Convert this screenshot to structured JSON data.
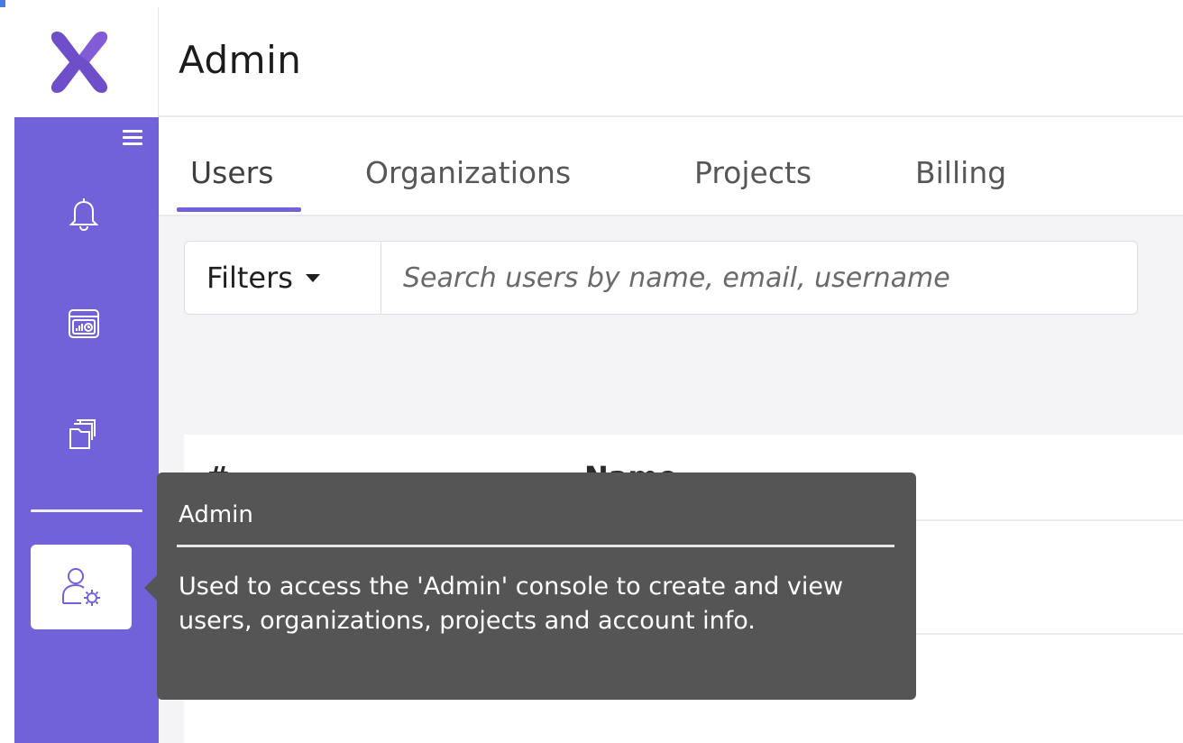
{
  "app": {
    "brand_color": "#7162d9",
    "logo_icon": "x-logo-icon"
  },
  "header": {
    "title": "Admin"
  },
  "sidebar": {
    "menu_icon": "hamburger-icon",
    "items": [
      {
        "icon": "bell-icon",
        "name": "notifications"
      },
      {
        "icon": "dashboard-chart-icon",
        "name": "dashboards"
      },
      {
        "icon": "folders-icon",
        "name": "projects"
      },
      {
        "icon": "user-gear-icon",
        "name": "admin",
        "active": true
      }
    ]
  },
  "tabs": [
    {
      "label": "Users",
      "active": true
    },
    {
      "label": "Organizations",
      "active": false
    },
    {
      "label": "Projects",
      "active": false
    },
    {
      "label": "Billing",
      "active": false
    }
  ],
  "search": {
    "filters_label": "Filters",
    "placeholder": "Search users by name, email, username"
  },
  "table": {
    "columns": [
      "#",
      "Name"
    ]
  },
  "tooltip": {
    "title": "Admin",
    "body": "Used to access the 'Admin' console to create and view users, organizations, projects and account info."
  }
}
